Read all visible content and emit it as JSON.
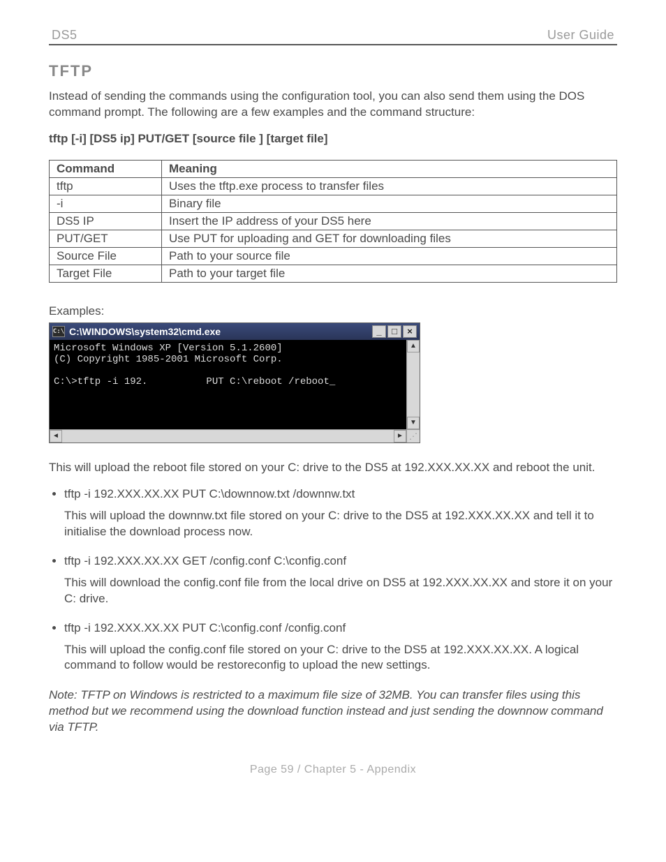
{
  "header": {
    "left": "DS5",
    "right": "User Guide"
  },
  "section": {
    "title": "TFTP"
  },
  "intro": "Instead of sending the commands using the configuration tool, you can also send them using the DOS command prompt. The following are a few examples and the command structure:",
  "syntax": "tftp  [-i]  [DS5 ip]  PUT/GET  [source file ]  [target file]",
  "table": {
    "headers": [
      "Command",
      "Meaning"
    ],
    "rows": [
      [
        "tftp",
        "Uses the tftp.exe process to transfer files"
      ],
      [
        "-i",
        "Binary file"
      ],
      [
        "DS5 IP",
        "Insert the IP address of your DS5 here"
      ],
      [
        "PUT/GET",
        "Use PUT for uploading and GET for downloading files"
      ],
      [
        "Source File",
        "Path to your source file"
      ],
      [
        "Target File",
        "Path to your target file"
      ]
    ]
  },
  "examples_label": "Examples:",
  "cmd_window": {
    "icon_text": "C:\\",
    "title": "C:\\WINDOWS\\system32\\cmd.exe",
    "buttons": {
      "min": "_",
      "max": "□",
      "close": "×"
    },
    "lines": [
      "Microsoft Windows XP [Version 5.1.2600]",
      "(C) Copyright 1985-2001 Microsoft Corp.",
      "",
      "C:\\>tftp -i 192.          PUT C:\\reboot /reboot_"
    ],
    "scroll": {
      "up": "▲",
      "down": "▼",
      "left": "◄",
      "right": "►"
    }
  },
  "after_cmd": "This will upload the reboot file stored on your C: drive to the DS5 at 192.XXX.XX.XX and reboot the unit.",
  "bullets": [
    {
      "cmd": "tftp -i 192.XXX.XX.XX PUT C:\\downnow.txt /downnw.txt",
      "desc": "This will upload the downnw.txt file stored on your C: drive to the DS5 at 192.XXX.XX.XX and tell it to initialise the download process now."
    },
    {
      "cmd": "tftp -i 192.XXX.XX.XX GET /config.conf C:\\config.conf",
      "desc": "This will download the config.conf file from the local drive on DS5 at 192.XXX.XX.XX and store it on your C: drive."
    },
    {
      "cmd": "tftp -i 192.XXX.XX.XX PUT C:\\config.conf /config.conf",
      "desc": "This will upload the config.conf file stored on your C: drive to the DS5 at 192.XXX.XX.XX. A logical command to follow would be restoreconfig to upload the new settings."
    }
  ],
  "note": "Note: TFTP on Windows is restricted to a maximum file size of 32MB. You can transfer files using this method but we recommend using the download function instead and just sending the downnow command via TFTP.",
  "footer": "Page 59  /  Chapter 5 - Appendix"
}
